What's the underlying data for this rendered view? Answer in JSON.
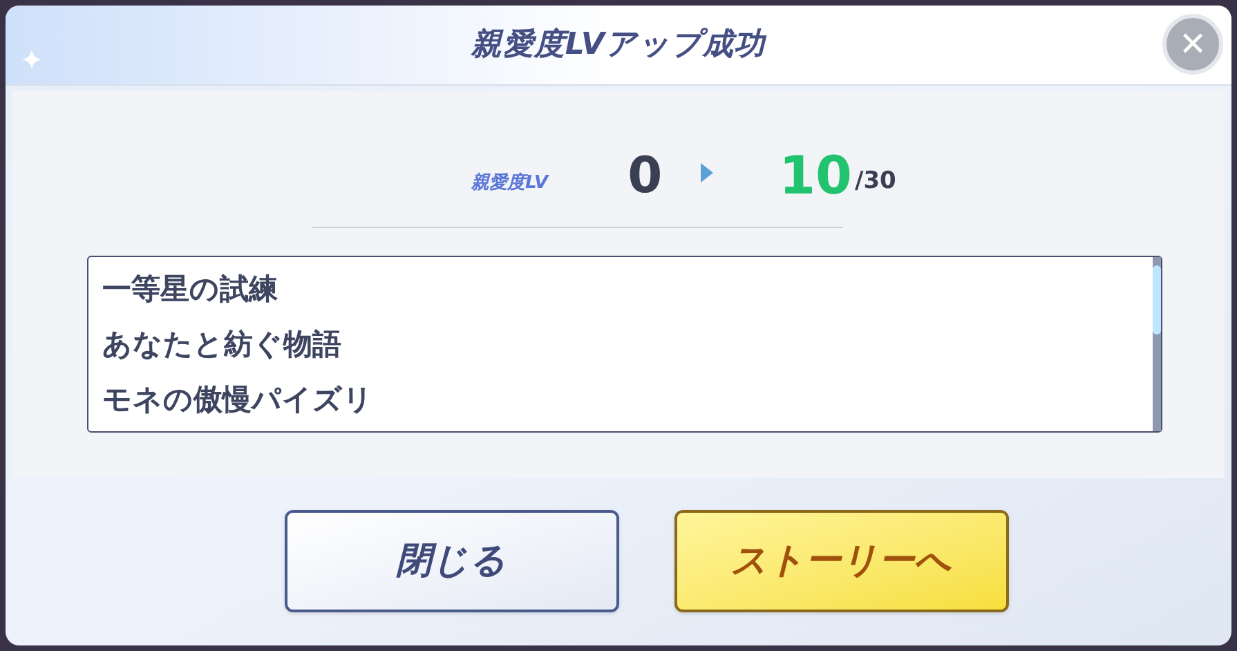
{
  "dialog": {
    "title": "親愛度LVアップ成功",
    "close_icon": "✕"
  },
  "level_up": {
    "label": "親愛度LV",
    "from": "0",
    "to": "10",
    "max": "/30"
  },
  "stories": [
    "一等星の試練",
    "あなたと紡ぐ物語",
    "モネの傲慢パイズリ"
  ],
  "buttons": [
    {
      "label": "閉じる",
      "kind": "secondary"
    },
    {
      "label": "ストーリーへ",
      "kind": "primary"
    }
  ]
}
